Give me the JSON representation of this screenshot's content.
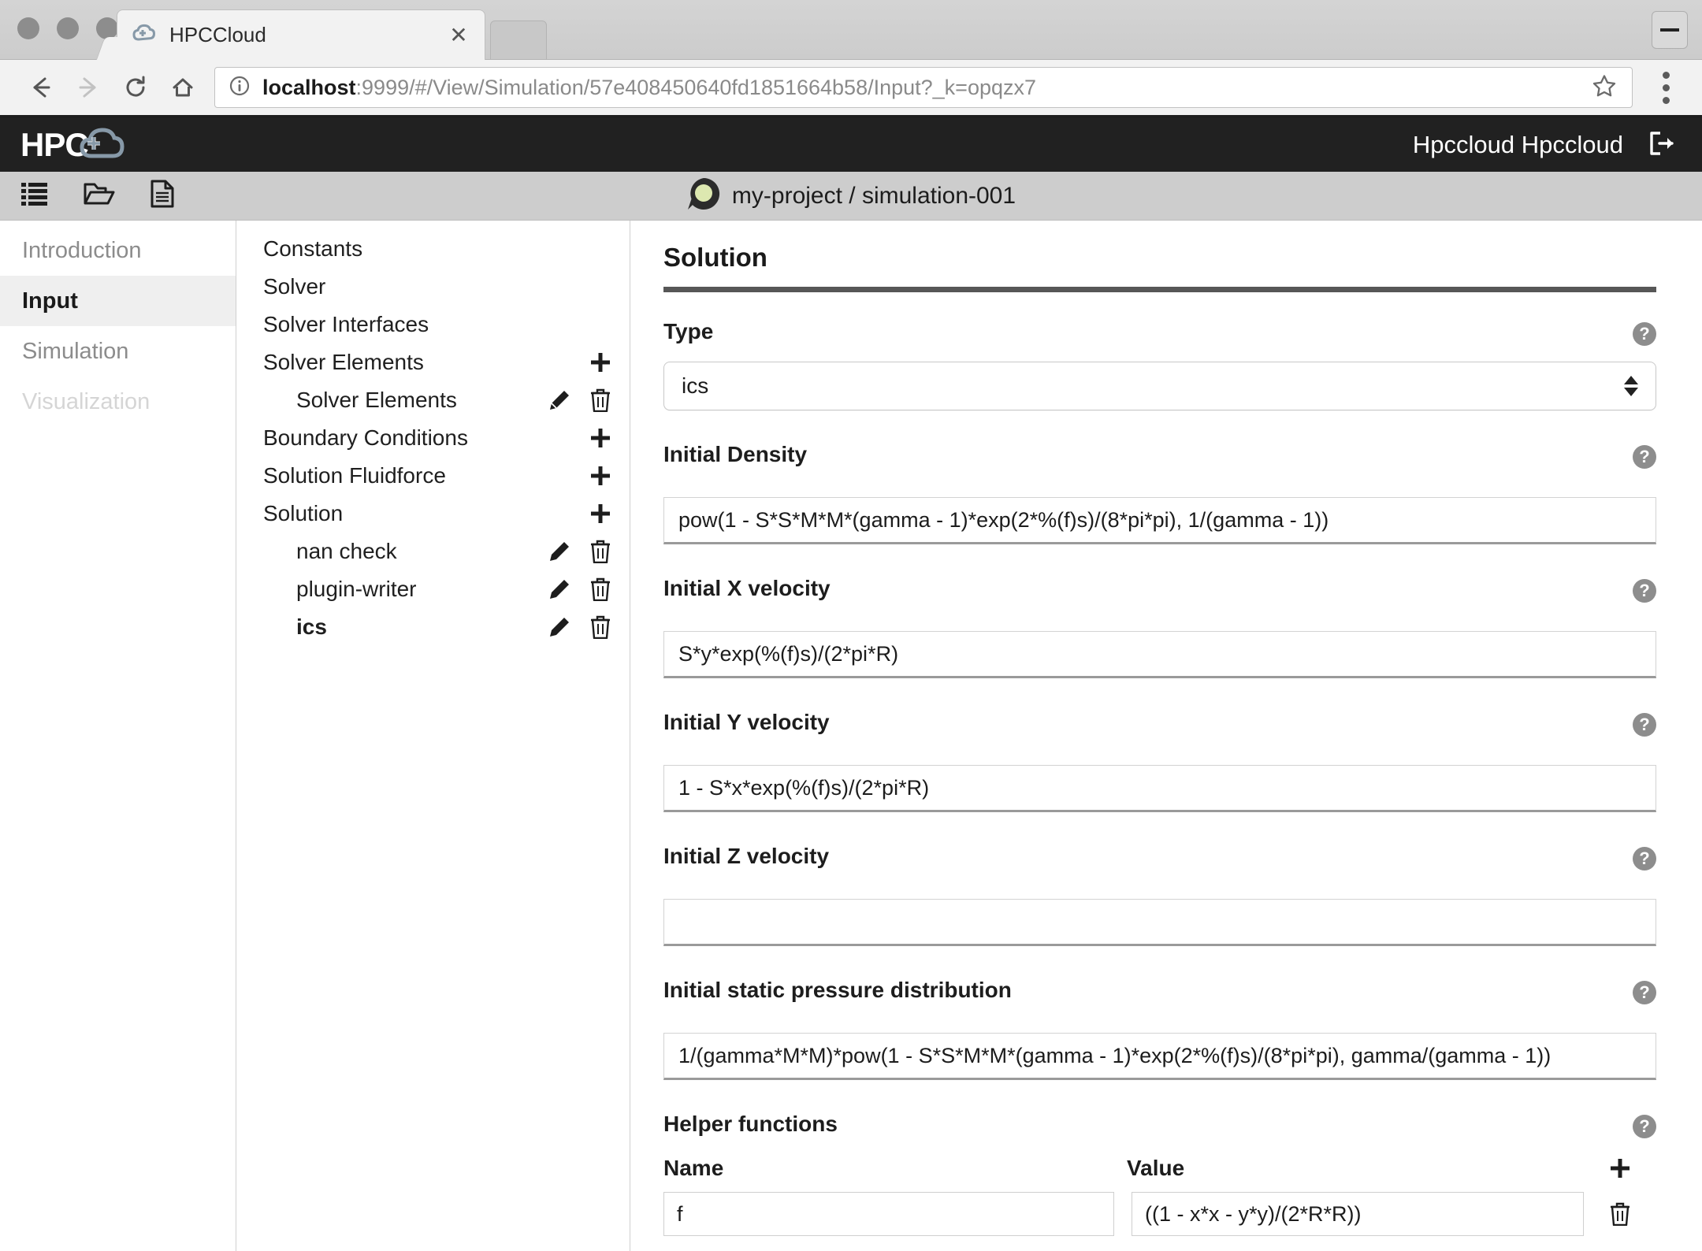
{
  "browser": {
    "tab": {
      "title": "HPCCloud",
      "favicon_icon": "hpccloud-favicon",
      "close_icon": "close-icon"
    },
    "window_controls": {
      "minimize_icon": "minimize-icon"
    },
    "nav": {
      "back_icon": "back-arrow-icon",
      "forward_icon": "forward-arrow-icon",
      "reload_icon": "reload-icon",
      "home_icon": "home-icon",
      "menu_icon": "kebab-menu-icon"
    },
    "omnibox": {
      "info_icon": "page-info-icon",
      "bookmark_icon": "star-icon",
      "url_host": "localhost",
      "url_rest": ":9999/#/View/Simulation/57e408450640fd1851664b58/Input?_k=opqzx7",
      "url_full": "localhost:9999/#/View/Simulation/57e408450640fd1851664b58/Input?_k=opqzx7"
    }
  },
  "appbar": {
    "logo_text": "HPC",
    "logo_icon": "cloud-plus-icon",
    "user_name": "Hpccloud Hpccloud",
    "logout_icon": "logout-icon",
    "bg_color": "#212121"
  },
  "projectbar": {
    "icons": [
      {
        "name": "list-icon",
        "label": "List"
      },
      {
        "name": "open-folder-icon",
        "label": "Projects"
      },
      {
        "name": "document-icon",
        "label": "Simulations"
      }
    ],
    "project_icon": "project-avatar-icon",
    "project_icon_color": "#dde8b0",
    "title": "my-project / simulation-001"
  },
  "leftnav": {
    "items": [
      {
        "label": "Introduction",
        "state": "normal"
      },
      {
        "label": "Input",
        "state": "active"
      },
      {
        "label": "Simulation",
        "state": "normal"
      },
      {
        "label": "Visualization",
        "state": "disabled"
      }
    ]
  },
  "tree": {
    "add_icon": "plus-icon",
    "edit_icon": "pencil-icon",
    "delete_icon": "trash-icon",
    "rows": [
      {
        "label": "Constants",
        "indent": 0,
        "bold": false,
        "add": false,
        "edit": false,
        "del": false
      },
      {
        "label": "Solver",
        "indent": 0,
        "bold": false,
        "add": false,
        "edit": false,
        "del": false
      },
      {
        "label": "Solver Interfaces",
        "indent": 0,
        "bold": false,
        "add": false,
        "edit": false,
        "del": false
      },
      {
        "label": "Solver Elements",
        "indent": 0,
        "bold": false,
        "add": true,
        "edit": false,
        "del": false
      },
      {
        "label": "Solver Elements",
        "indent": 1,
        "bold": false,
        "add": false,
        "edit": true,
        "del": true
      },
      {
        "label": "Boundary Conditions",
        "indent": 0,
        "bold": false,
        "add": true,
        "edit": false,
        "del": false
      },
      {
        "label": "Solution Fluidforce",
        "indent": 0,
        "bold": false,
        "add": true,
        "edit": false,
        "del": false
      },
      {
        "label": "Solution",
        "indent": 0,
        "bold": false,
        "add": true,
        "edit": false,
        "del": false
      },
      {
        "label": "nan check",
        "indent": 1,
        "bold": false,
        "add": false,
        "edit": true,
        "del": true
      },
      {
        "label": "plugin-writer",
        "indent": 1,
        "bold": false,
        "add": false,
        "edit": true,
        "del": true
      },
      {
        "label": "ics",
        "indent": 1,
        "bold": true,
        "add": false,
        "edit": true,
        "del": true
      }
    ]
  },
  "main": {
    "panel_title": "Solution",
    "help_icon": "help-icon",
    "type_field": {
      "label": "Type",
      "value": "ics",
      "options": [
        "ics"
      ]
    },
    "fields": [
      {
        "label": "Initial Density",
        "value": "pow(1 - S*S*M*M*(gamma - 1)*exp(2*%(f)s)/(8*pi*pi), 1/(gamma - 1))"
      },
      {
        "label": "Initial X velocity",
        "value": "S*y*exp(%(f)s)/(2*pi*R)"
      },
      {
        "label": "Initial Y velocity",
        "value": "1 - S*x*exp(%(f)s)/(2*pi*R)"
      },
      {
        "label": "Initial Z velocity",
        "value": ""
      },
      {
        "label": "Initial static pressure distribution",
        "value": "1/(gamma*M*M)*pow(1 - S*S*M*M*(gamma - 1)*exp(2*%(f)s)/(8*pi*pi), gamma/(gamma - 1))"
      }
    ],
    "helper": {
      "label": "Helper functions",
      "col_name": "Name",
      "col_value": "Value",
      "add_icon": "plus-icon",
      "delete_icon": "trash-icon",
      "rows": [
        {
          "name": "f",
          "value": "((1 - x*x - y*y)/(2*R*R))"
        }
      ]
    }
  }
}
